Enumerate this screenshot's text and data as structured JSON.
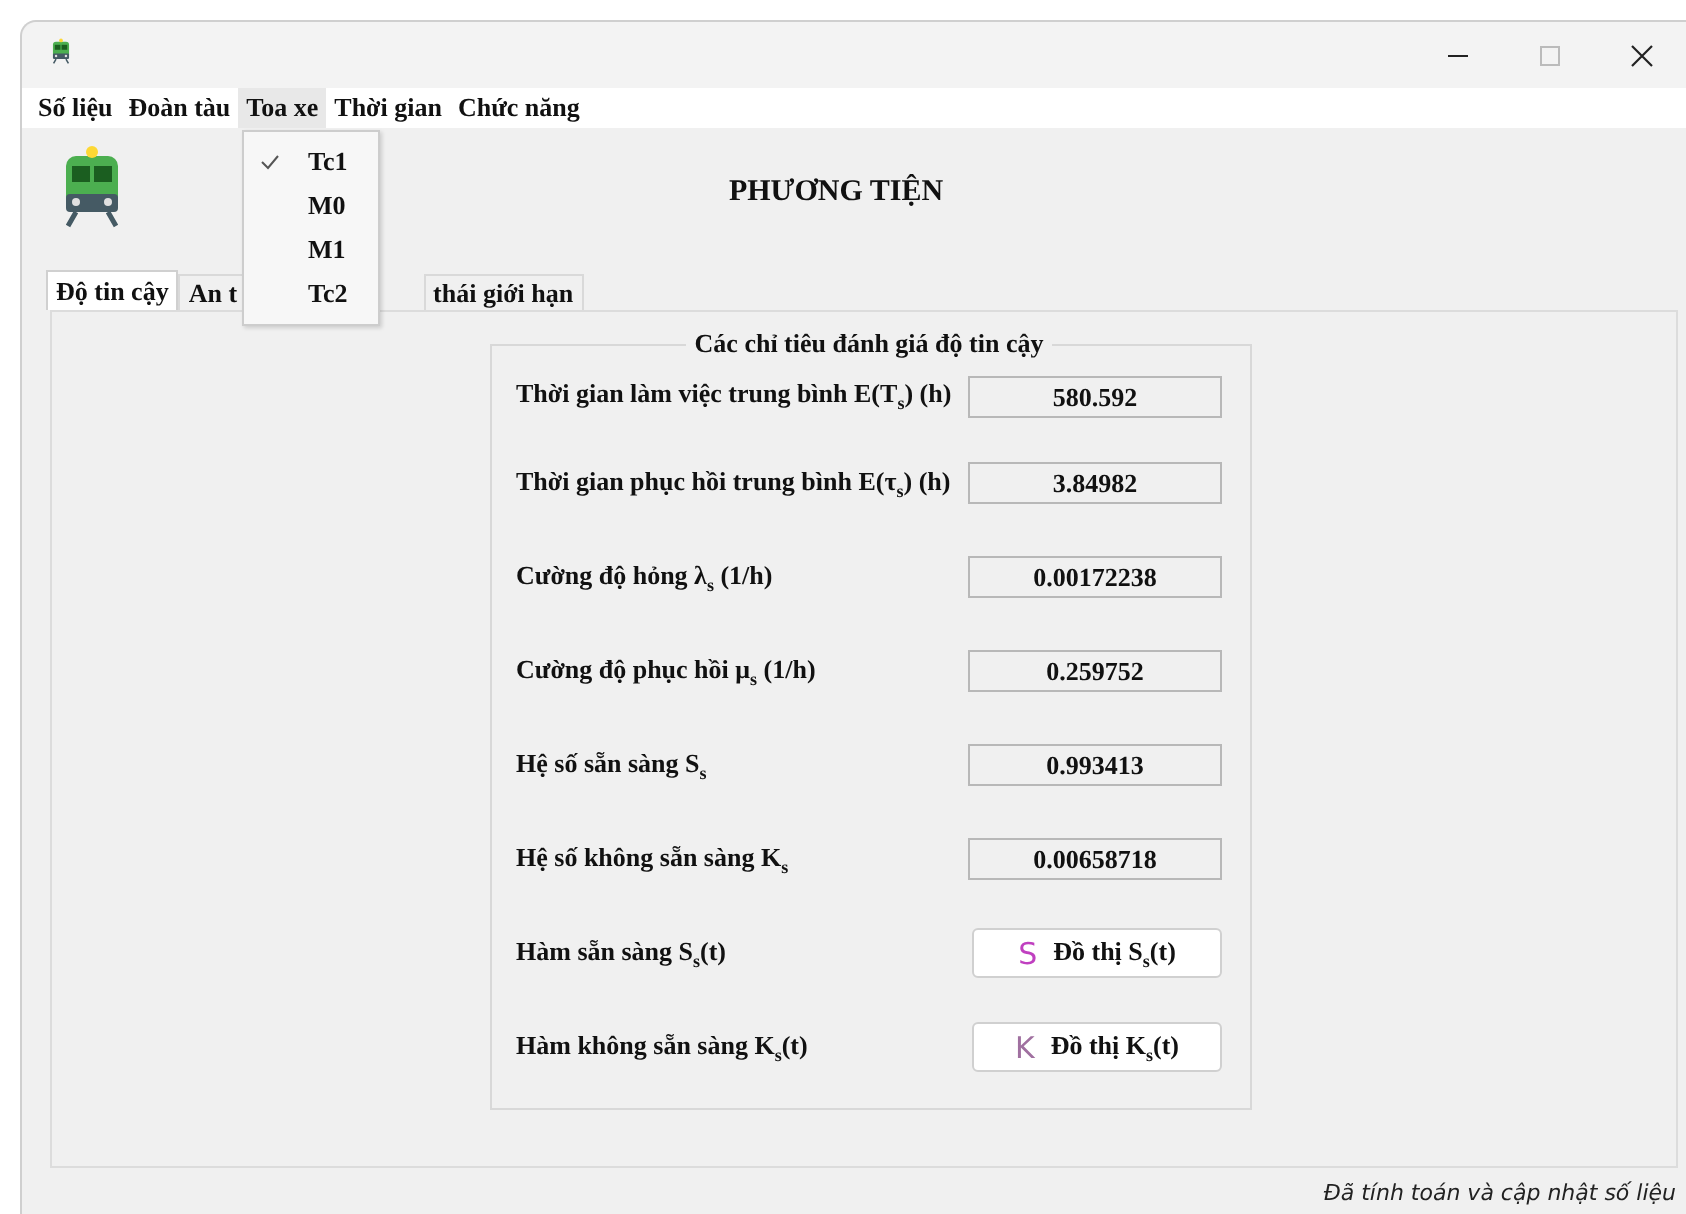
{
  "menu": [
    {
      "label": "Số liệu",
      "selected": false
    },
    {
      "label": "Đoàn tàu",
      "selected": false
    },
    {
      "label": "Toa xe",
      "selected": true
    },
    {
      "label": "Thời gian",
      "selected": false
    },
    {
      "label": "Chức năng",
      "selected": false
    }
  ],
  "dropdown": [
    {
      "label": "Tc1",
      "checked": true
    },
    {
      "label": "M0",
      "checked": false
    },
    {
      "label": "M1",
      "checked": false
    },
    {
      "label": "Tc2",
      "checked": false
    }
  ],
  "heading": "PHƯƠNG TIỆN",
  "tabs": [
    {
      "label": "Độ tin cậy",
      "selected": true
    },
    {
      "label": "An t",
      "selected": false
    },
    {
      "label": "thái giới hạn",
      "selected": false
    }
  ],
  "group": {
    "title": "Các chỉ tiêu đánh giá độ tin cậy",
    "rows": [
      {
        "kind": "value",
        "label": "Thời gian làm việc trung bình E(T$_{s}$) (h)",
        "value": "580.592"
      },
      {
        "kind": "value",
        "label": "Thời gian phục hồi trung bình E(τ$_{s}$) (h)",
        "value": "3.84982"
      },
      {
        "kind": "value",
        "label": "Cường độ hỏng λ$_{s}$ (1/h)",
        "value": "0.00172238"
      },
      {
        "kind": "value",
        "label": "Cường độ phục hồi μ$_{s}$ (1/h)",
        "value": "0.259752"
      },
      {
        "kind": "value",
        "label": "Hệ số sẵn sàng S$_{s}$",
        "value": "0.993413"
      },
      {
        "kind": "value",
        "label": "Hệ số không sẵn sàng K$_{s}$",
        "value": "0.00658718"
      },
      {
        "kind": "button",
        "label": "Hàm sẵn sàng S$_{s}$(t)",
        "icon": "S",
        "color": "#c040c0",
        "button": "Đồ thị S$_{s}$(t)"
      },
      {
        "kind": "button",
        "label": "Hàm không sẵn sàng K$_{s}$(t)",
        "icon": "K",
        "color": "#a070a0",
        "button": "Đồ thị K$_{s}$(t)"
      }
    ]
  },
  "status_bar": "Đã tính toán và cập nhật số liệu"
}
